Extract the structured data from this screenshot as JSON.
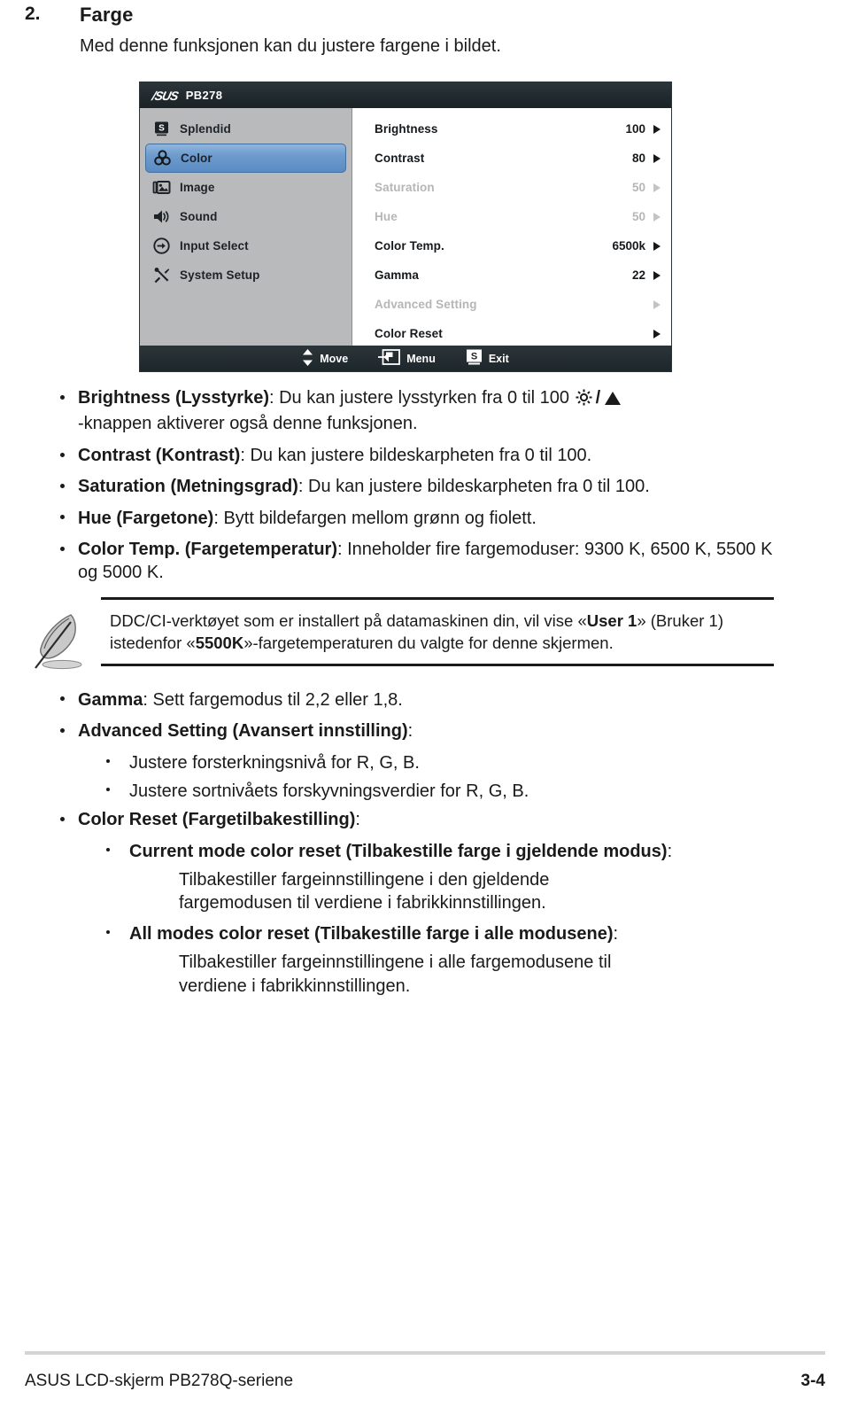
{
  "section": {
    "number": "2.",
    "title": "Farge",
    "description": "Med denne funksjonen kan du justere fargene i bildet."
  },
  "osd": {
    "brand": "/SUS",
    "model": "PB278",
    "sidebar": [
      {
        "icon": "splendid-icon",
        "label": "Splendid",
        "selected": false
      },
      {
        "icon": "color-icon",
        "label": "Color",
        "selected": true
      },
      {
        "icon": "image-icon",
        "label": "Image",
        "selected": false
      },
      {
        "icon": "sound-icon",
        "label": "Sound",
        "selected": false
      },
      {
        "icon": "input-select-icon",
        "label": "Input Select",
        "selected": false
      },
      {
        "icon": "system-setup-icon",
        "label": "System Setup",
        "selected": false
      }
    ],
    "options": [
      {
        "name": "Brightness",
        "value": "100",
        "dim": false,
        "arrow": true
      },
      {
        "name": "Contrast",
        "value": "80",
        "dim": false,
        "arrow": true
      },
      {
        "name": "Saturation",
        "value": "50",
        "dim": true,
        "arrow": true
      },
      {
        "name": "Hue",
        "value": "50",
        "dim": true,
        "arrow": true
      },
      {
        "name": "Color Temp.",
        "value": "6500k",
        "dim": false,
        "arrow": true
      },
      {
        "name": "Gamma",
        "value": "22",
        "dim": false,
        "arrow": true
      },
      {
        "name": "Advanced Setting",
        "value": "",
        "dim": true,
        "arrow": true
      },
      {
        "name": "Color Reset",
        "value": "",
        "dim": false,
        "arrow": true
      }
    ],
    "footer": [
      {
        "icon": "up-down-arrows-icon",
        "label": "Move"
      },
      {
        "icon": "menu-enter-icon",
        "label": "Menu"
      },
      {
        "icon": "splendid-s-icon",
        "label": "Exit"
      }
    ],
    "colors": {
      "title_bar": "#232c30",
      "sidebar_bg": "#b9babc",
      "selection_blue": "#6d9bcd",
      "panel_bg": "#ffffff",
      "dim_text": "#b4b6b8"
    }
  },
  "bullets": {
    "brightness": {
      "term": "Brightness (Lysstyrke)",
      "text_before": ": Du kan justere lysstyrken fra 0 til 100 ",
      "text_after": "-knappen aktiverer også denne funksjonen."
    },
    "contrast": {
      "term": "Contrast (Kontrast)",
      "text": ": Du kan justere bildeskarpheten fra 0 til 100."
    },
    "saturation": {
      "term": "Saturation (Metningsgrad)",
      "text": ": Du kan justere bildeskarpheten fra 0 til 100."
    },
    "hue": {
      "term": "Hue (Fargetone)",
      "text": ": Bytt bildefargen mellom grønn og fiolett."
    },
    "color_temp": {
      "term": "Color Temp. (Fargetemperatur)",
      "text": ": Inneholder fire fargemoduser: 9300 K, 6500 K, 5500 K og 5000 K."
    },
    "gamma": {
      "term": "Gamma",
      "text": ": Sett fargemodus til 2,2 eller 1,8."
    },
    "advanced_setting": {
      "term": "Advanced Setting (Avansert innstilling)",
      "text": ":",
      "sub": [
        "Justere forsterkningsnivå for R, G, B.",
        "Justere sortnivåets forskyvningsverdier for R, G, B."
      ]
    },
    "color_reset": {
      "term": "Color Reset (Fargetilbakestilling)",
      "text": ":",
      "sub": [
        {
          "term": "Current mode color reset (Tilbakestille farge i gjeldende modus)",
          "suffix": ":",
          "body": "Tilbakestiller fargeinnstillingene i den gjeldende fargemodusen til verdiene i fabrikkinnstillingen."
        },
        {
          "term": "All modes color reset (Tilbakestille farge i alle modusene)",
          "suffix": ":",
          "body": "Tilbakestiller fargeinnstillingene i alle fargemodusene til verdiene i fabrikkinnstillingen."
        }
      ]
    }
  },
  "note": {
    "icon": "feather-pen-icon",
    "part1": "DDC/CI-verktøyet som er installert på datamaskinen din, vil vise «",
    "bold1": "User 1",
    "part2": "» (Bruker 1) istedenfor «",
    "bold2": "5500K",
    "part3": "»-fargetemperaturen du valgte for denne skjermen."
  },
  "footer": {
    "left": "ASUS LCD-skjerm PB278Q-seriene",
    "right": "3-4"
  }
}
